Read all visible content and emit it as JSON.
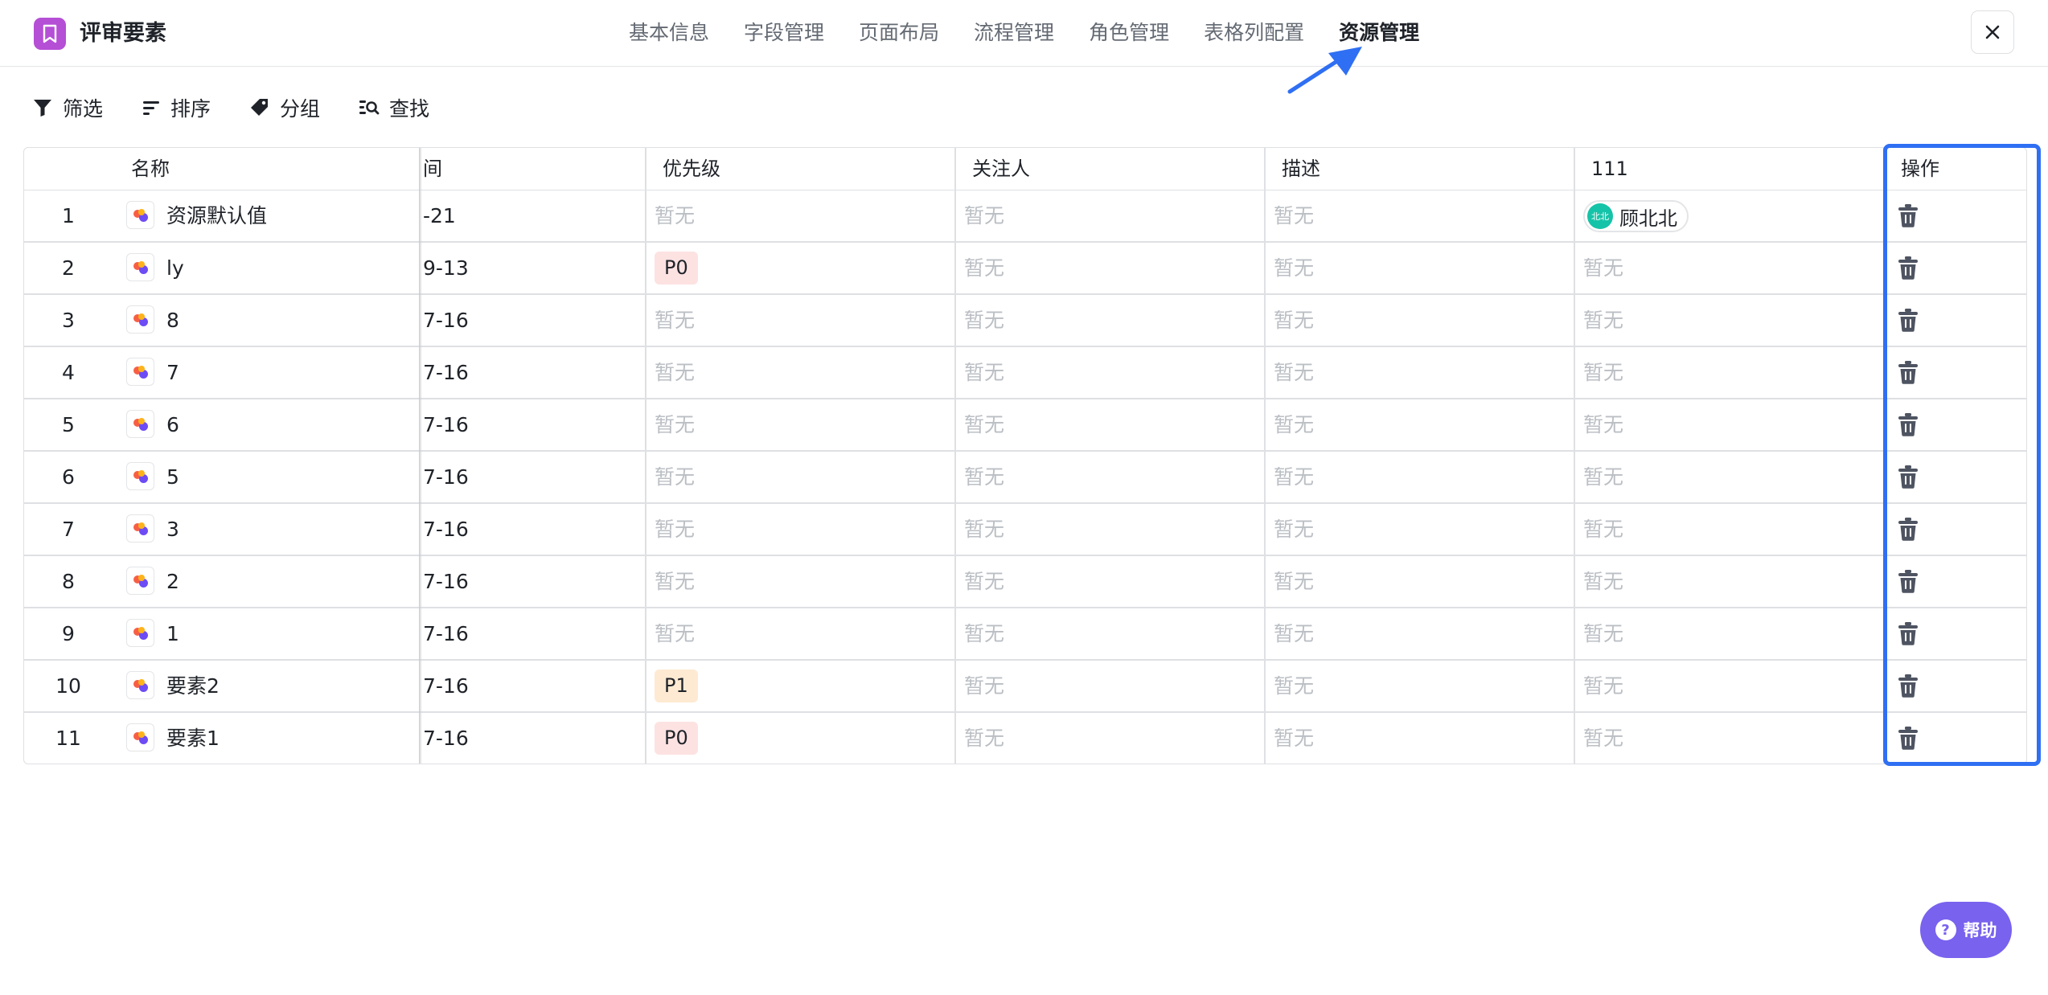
{
  "header": {
    "title": "评审要素",
    "tabs": [
      "基本信息",
      "字段管理",
      "页面布局",
      "流程管理",
      "角色管理",
      "表格列配置",
      "资源管理"
    ],
    "active_tab": "资源管理"
  },
  "toolbar": {
    "filter": "筛选",
    "sort": "排序",
    "group": "分组",
    "search": "查找"
  },
  "table": {
    "columns": {
      "name": "名称",
      "time": "间",
      "priority": "优先级",
      "followers": "关注人",
      "description": "描述",
      "custom": "111",
      "actions": "操作"
    },
    "empty_text": "暂无",
    "rows": [
      {
        "num": "1",
        "name": "资源默认值",
        "time": "-21",
        "priority": "",
        "custom_user": "顾北北",
        "custom_avatar": "北北"
      },
      {
        "num": "2",
        "name": "ly",
        "time": "9-13",
        "priority": "P0",
        "custom_user": ""
      },
      {
        "num": "3",
        "name": "8",
        "time": "7-16",
        "priority": "",
        "custom_user": ""
      },
      {
        "num": "4",
        "name": "7",
        "time": "7-16",
        "priority": "",
        "custom_user": ""
      },
      {
        "num": "5",
        "name": "6",
        "time": "7-16",
        "priority": "",
        "custom_user": ""
      },
      {
        "num": "6",
        "name": "5",
        "time": "7-16",
        "priority": "",
        "custom_user": ""
      },
      {
        "num": "7",
        "name": "3",
        "time": "7-16",
        "priority": "",
        "custom_user": ""
      },
      {
        "num": "8",
        "name": "2",
        "time": "7-16",
        "priority": "",
        "custom_user": ""
      },
      {
        "num": "9",
        "name": "1",
        "time": "7-16",
        "priority": "",
        "custom_user": ""
      },
      {
        "num": "10",
        "name": "要素2",
        "time": "7-16",
        "priority": "P1",
        "custom_user": ""
      },
      {
        "num": "11",
        "name": "要素1",
        "time": "7-16",
        "priority": "P0",
        "custom_user": ""
      }
    ]
  },
  "help": {
    "label": "帮助",
    "icon": "?"
  },
  "colors": {
    "app_icon": "#b54fd6",
    "highlight": "#2f6ff3",
    "help_button": "#7862ee",
    "p0_bg": "#fde2e2",
    "p1_bg": "#feead2",
    "avatar": "#15c3a8"
  }
}
